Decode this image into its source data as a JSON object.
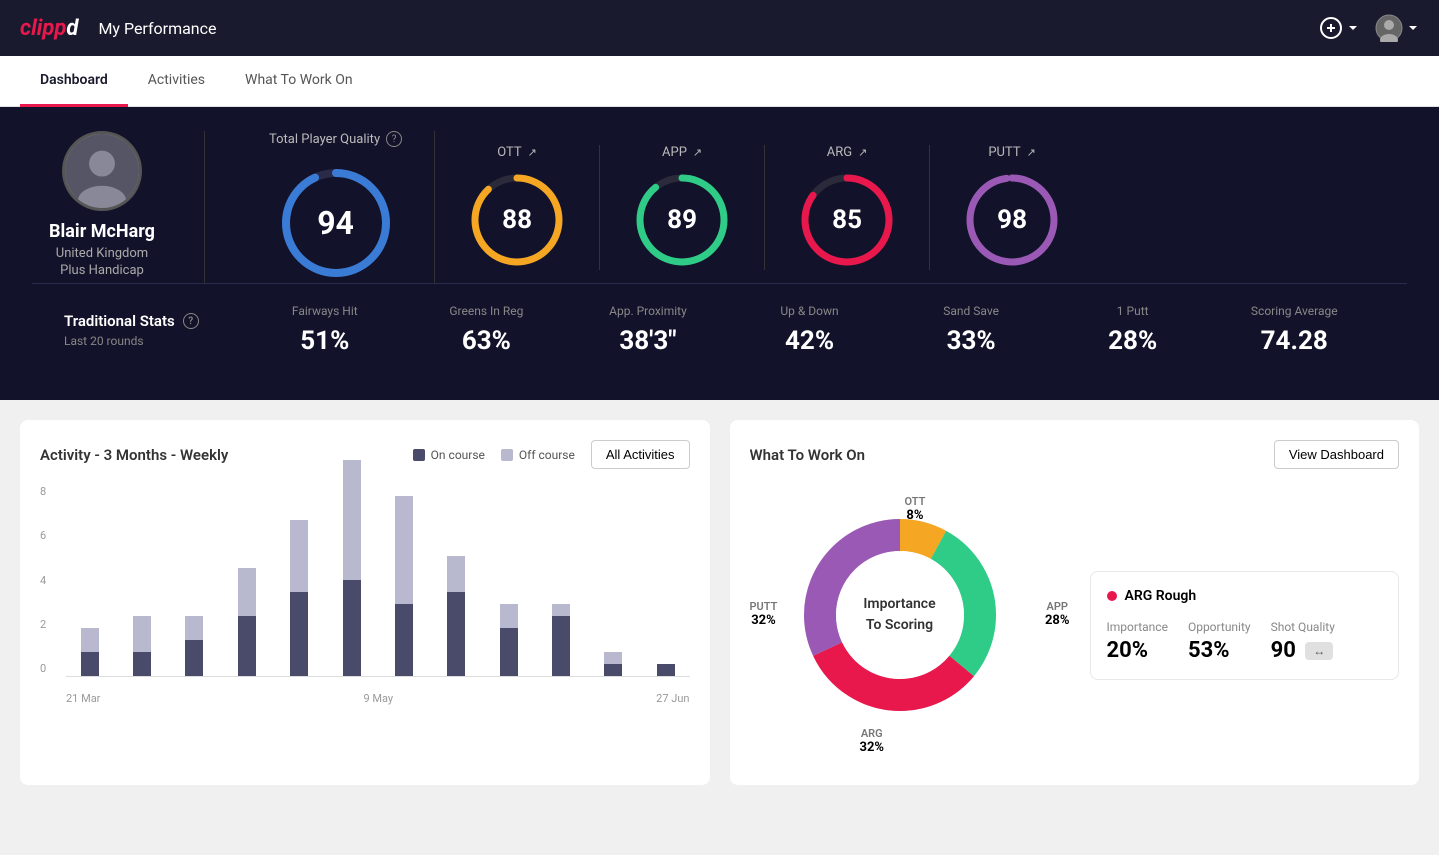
{
  "app": {
    "logo": "clippd",
    "nav_title": "My Performance",
    "add_icon": "⊕",
    "avatar_icon": "👤"
  },
  "tabs": [
    {
      "id": "dashboard",
      "label": "Dashboard",
      "active": true
    },
    {
      "id": "activities",
      "label": "Activities",
      "active": false
    },
    {
      "id": "what-to-work-on",
      "label": "What To Work On",
      "active": false
    }
  ],
  "hero": {
    "player_name": "Blair McHarg",
    "country": "United Kingdom",
    "handicap": "Plus Handicap",
    "total_player_quality_label": "Total Player Quality",
    "total_score": "94",
    "categories": [
      {
        "id": "ott",
        "label": "OTT",
        "score": "88",
        "color": "#f5a623",
        "pct": 88
      },
      {
        "id": "app",
        "label": "APP",
        "score": "89",
        "color": "#2ecc87",
        "pct": 89
      },
      {
        "id": "arg",
        "label": "ARG",
        "score": "85",
        "color": "#e8184d",
        "pct": 85
      },
      {
        "id": "putt",
        "label": "PUTT",
        "score": "98",
        "color": "#9b59b6",
        "pct": 98
      }
    ]
  },
  "traditional_stats": {
    "label": "Traditional Stats",
    "sublabel": "Last 20 rounds",
    "stats": [
      {
        "name": "Fairways Hit",
        "value": "51%"
      },
      {
        "name": "Greens In Reg",
        "value": "63%"
      },
      {
        "name": "App. Proximity",
        "value": "38'3\""
      },
      {
        "name": "Up & Down",
        "value": "42%"
      },
      {
        "name": "Sand Save",
        "value": "33%"
      },
      {
        "name": "1 Putt",
        "value": "28%"
      },
      {
        "name": "Scoring Average",
        "value": "74.28"
      }
    ]
  },
  "activity_chart": {
    "title": "Activity - 3 Months - Weekly",
    "legend_on_course": "On course",
    "legend_off_course": "Off course",
    "all_activities_btn": "All Activities",
    "y_labels": [
      "8",
      "6",
      "4",
      "2",
      "0"
    ],
    "x_labels": [
      "21 Mar",
      "9 May",
      "27 Jun"
    ],
    "bars": [
      {
        "on": 1,
        "off": 1
      },
      {
        "on": 1,
        "off": 1.5
      },
      {
        "on": 1.5,
        "off": 1
      },
      {
        "on": 2.5,
        "off": 2
      },
      {
        "on": 3.5,
        "off": 3
      },
      {
        "on": 4,
        "off": 5
      },
      {
        "on": 3,
        "off": 4.5
      },
      {
        "on": 3.5,
        "off": 1.5
      },
      {
        "on": 2,
        "off": 1
      },
      {
        "on": 2.5,
        "off": 0.5
      },
      {
        "on": 0.5,
        "off": 0.5
      },
      {
        "on": 0.5,
        "off": 0
      }
    ]
  },
  "what_to_work_on": {
    "title": "What To Work On",
    "view_dashboard_btn": "View Dashboard",
    "donut_center_line1": "Importance",
    "donut_center_line2": "To Scoring",
    "segments": [
      {
        "label": "OTT",
        "pct": "8%",
        "color": "#f5a623",
        "position": "top"
      },
      {
        "label": "APP",
        "pct": "28%",
        "color": "#2ecc87",
        "position": "right"
      },
      {
        "label": "ARG",
        "pct": "32%",
        "color": "#e8184d",
        "position": "bottom"
      },
      {
        "label": "PUTT",
        "pct": "32%",
        "color": "#9b59b6",
        "position": "left"
      }
    ],
    "info_card": {
      "title": "ARG Rough",
      "dot_color": "#e8184d",
      "stats": [
        {
          "label": "Importance",
          "value": "20%"
        },
        {
          "label": "Opportunity",
          "value": "53%"
        },
        {
          "label": "Shot Quality",
          "value": "90",
          "badge": ""
        }
      ]
    }
  }
}
